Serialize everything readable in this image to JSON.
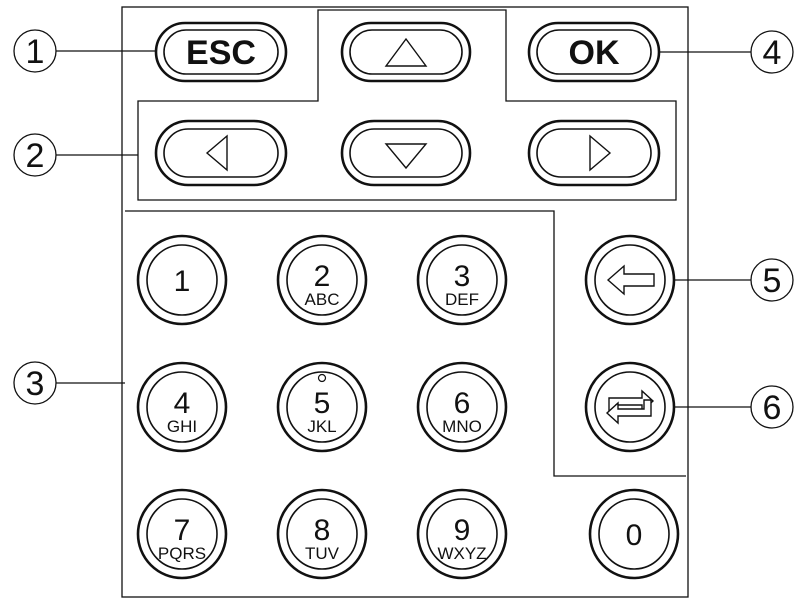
{
  "callouts": [
    "1",
    "2",
    "3",
    "4",
    "5",
    "6"
  ],
  "buttons": {
    "esc": "ESC",
    "ok": "OK",
    "up": "up-arrow-icon",
    "down": "down-arrow-icon",
    "left": "left-arrow-icon",
    "right": "right-arrow-icon",
    "backspace": "backspace-arrow-icon",
    "switch": "switch-cycle-icon"
  },
  "keys": [
    {
      "digit": "1",
      "letters": ""
    },
    {
      "digit": "2",
      "letters": "ABC"
    },
    {
      "digit": "3",
      "letters": "DEF"
    },
    {
      "digit": "4",
      "letters": "GHI"
    },
    {
      "digit": "5",
      "letters": "JKL"
    },
    {
      "digit": "6",
      "letters": "MNO"
    },
    {
      "digit": "7",
      "letters": "PQRS"
    },
    {
      "digit": "8",
      "letters": "TUV"
    },
    {
      "digit": "9",
      "letters": "WXYZ"
    },
    {
      "digit": "0",
      "letters": ""
    }
  ],
  "colors": {
    "stroke": "#111111",
    "background": "#ffffff"
  }
}
